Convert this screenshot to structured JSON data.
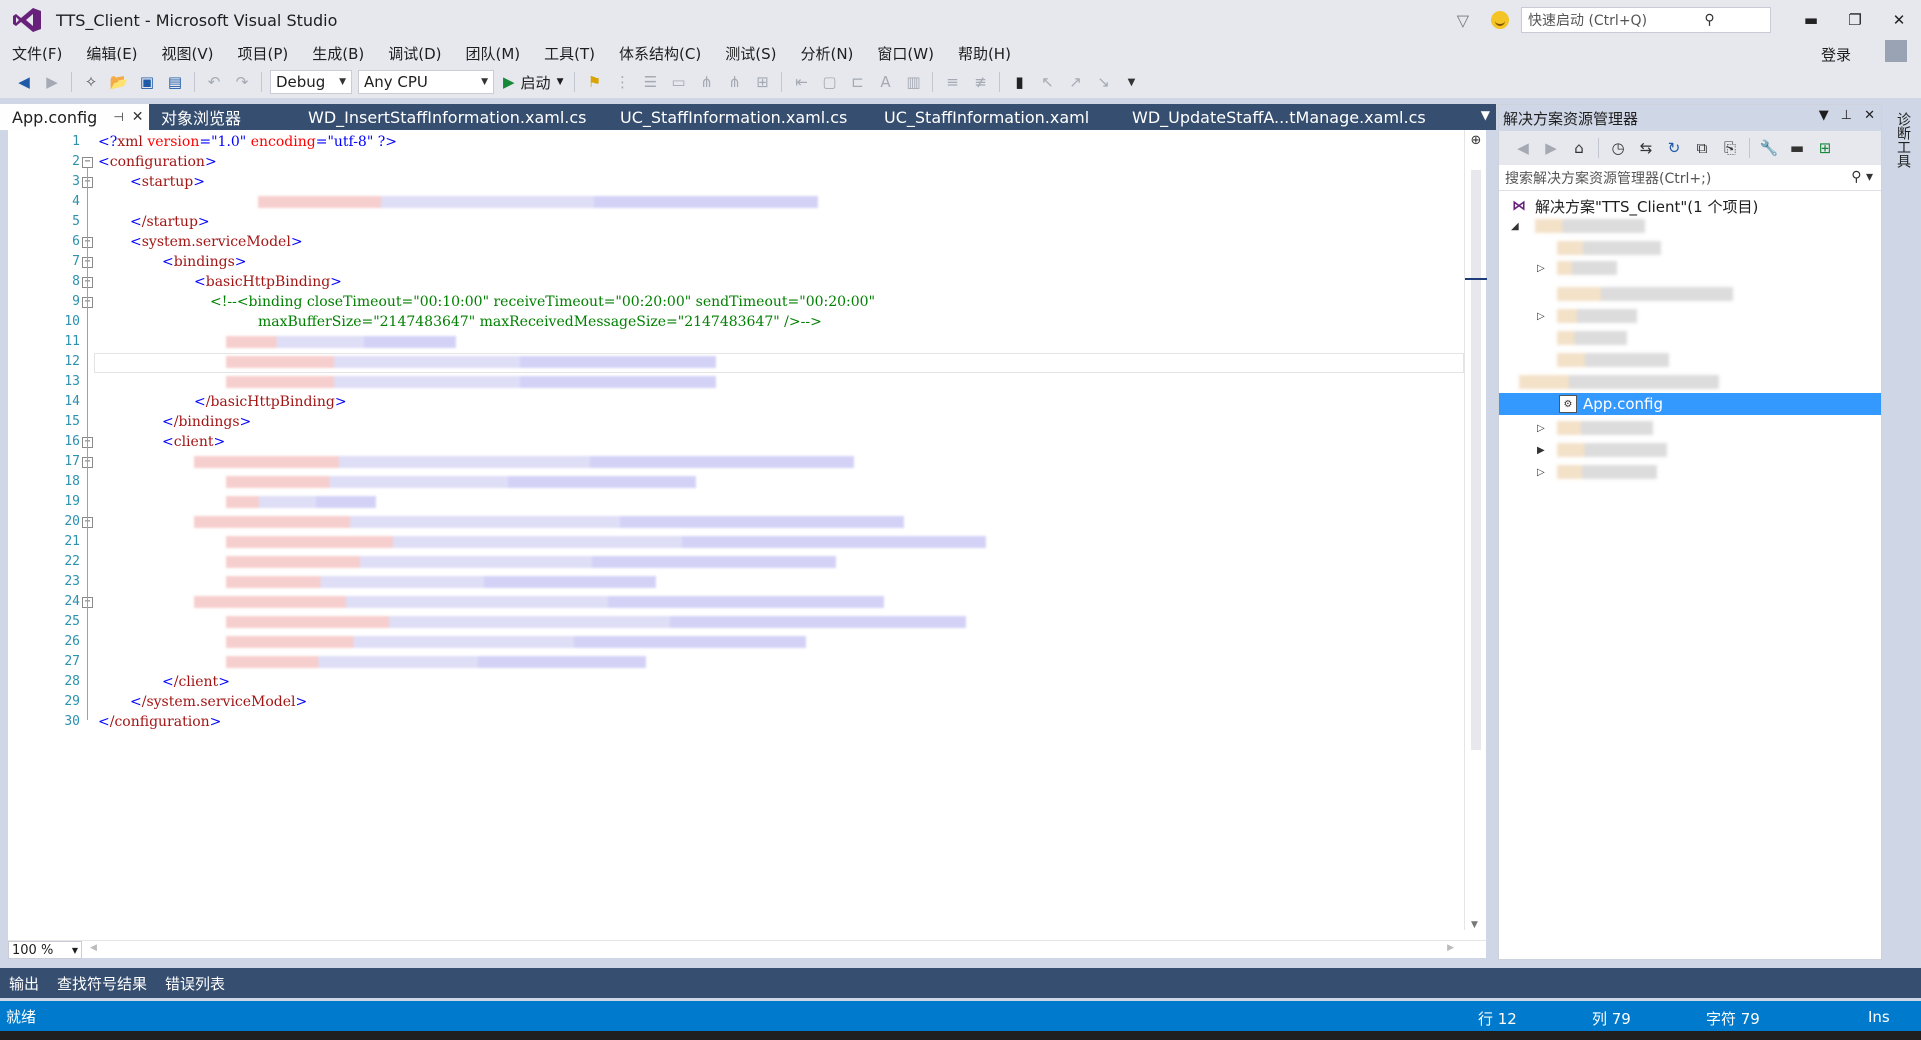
{
  "window": {
    "title": "TTS_Client - Microsoft Visual Studio",
    "quick_launch_placeholder": "快速启动 (Ctrl+Q)",
    "login": "登录"
  },
  "menu": [
    "文件(F)",
    "编辑(E)",
    "视图(V)",
    "项目(P)",
    "生成(B)",
    "调试(D)",
    "团队(M)",
    "工具(T)",
    "体系结构(C)",
    "测试(S)",
    "分析(N)",
    "窗口(W)",
    "帮助(H)"
  ],
  "toolbar": {
    "configuration": "Debug",
    "platform": "Any CPU",
    "run_label": "启动"
  },
  "tabs": [
    {
      "label": "App.config",
      "active": true
    },
    {
      "label": "对象浏览器"
    },
    {
      "label": "WD_InsertStaffInformation.xaml.cs"
    },
    {
      "label": "UC_StaffInformation.xaml.cs"
    },
    {
      "label": "UC_StaffInformation.xaml"
    },
    {
      "label": "WD_UpdateStaffA...tManage.xaml.cs"
    }
  ],
  "editor": {
    "line_numbers": [
      "1",
      "2",
      "3",
      "4",
      "5",
      "6",
      "7",
      "8",
      "9",
      "10",
      "11",
      "12",
      "13",
      "14",
      "15",
      "16",
      "17",
      "18",
      "19",
      "20",
      "21",
      "22",
      "23",
      "24",
      "25",
      "26",
      "27",
      "28",
      "29",
      "30"
    ],
    "code": {
      "l1_open": "<?",
      "l1_tag": "xml",
      "l1_a1": " version",
      "l1_eq1": "=",
      "l1_v1": "\"1.0\"",
      "l1_a2": " encoding",
      "l1_eq2": "=",
      "l1_v2": "\"utf-8\"",
      "l1_close": " ?>",
      "l2": "configuration",
      "l3": "startup",
      "l5": "/startup",
      "l6": "system.serviceModel",
      "l7": "bindings",
      "l8": "basicHttpBinding",
      "l9": "<!--<binding closeTimeout=\"00:10:00\" receiveTimeout=\"00:20:00\" sendTimeout=\"00:20:00\"",
      "l10": "maxBufferSize=\"2147483647\" maxReceivedMessageSize=\"2147483647\" />-->",
      "l14": "/basicHttpBinding",
      "l15": "/bindings",
      "l16": "client",
      "l28": "/client",
      "l29": "/system.serviceModel",
      "l30": "/configuration"
    },
    "zoom": "100 %"
  },
  "solution_explorer": {
    "title": "解决方案资源管理器",
    "search_placeholder": "搜索解决方案资源管理器(Ctrl+;)",
    "solution_label": "解决方案\"TTS_Client\"(1 个项目)",
    "selected_item": "App.config"
  },
  "side_tab": "诊断工具",
  "bottom_tabs": [
    "输出",
    "查找符号结果",
    "错误列表"
  ],
  "status": {
    "message": "就绪",
    "line": "行 12",
    "col": "列 79",
    "char": "字符 79",
    "mode": "Ins"
  }
}
